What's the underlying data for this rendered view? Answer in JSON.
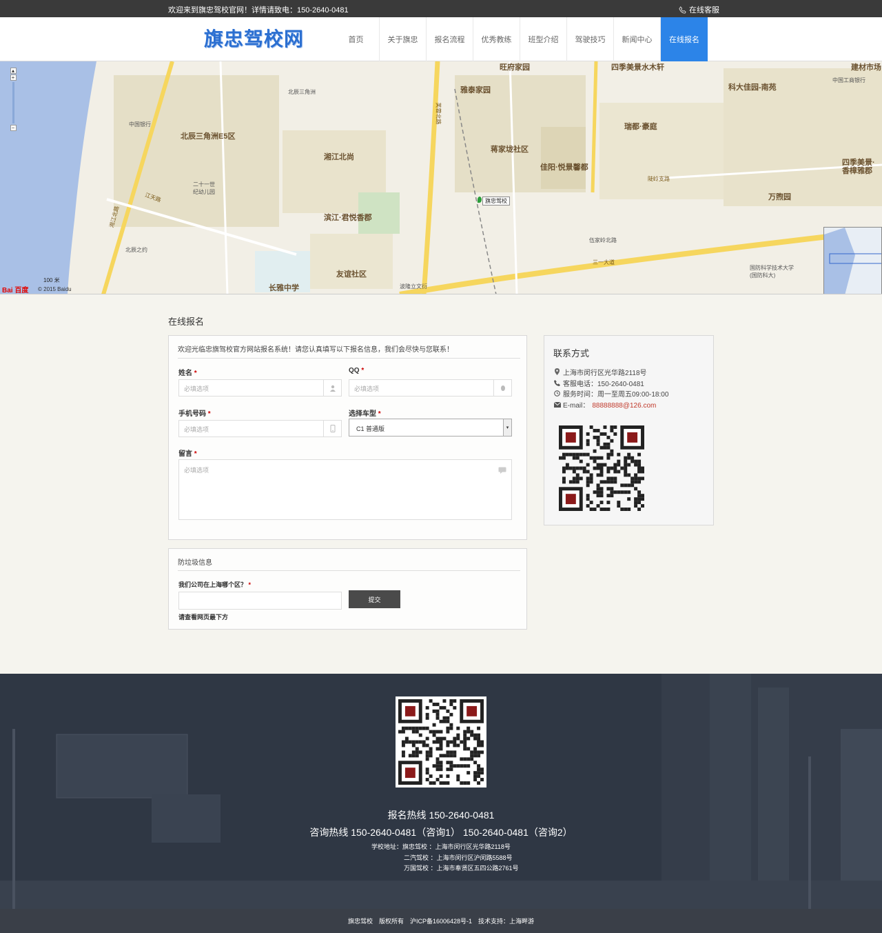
{
  "topbar": {
    "welcome": "欢迎来到旗忠驾校官网！详情请致电：150-2640-0481",
    "service": "在线客服"
  },
  "header": {
    "logo": "旗忠驾校网",
    "nav": [
      "首页",
      "关于旗忠",
      "报名流程",
      "优秀教练",
      "班型介绍",
      "驾驶技巧",
      "新闻中心",
      "在线报名"
    ],
    "active_nav": "在线报名"
  },
  "map": {
    "labels": {
      "l1": "北辰三角洲E5区",
      "l2": "湘江北尚",
      "l3": "滨江·君悦香郡",
      "l4": "雅泰家园",
      "l5": "蒋家垅社区",
      "l6": "佳阳·悦景馨都",
      "l7": "瑞都·豪庭",
      "l8": "科大佳园-南苑",
      "l9": "四季美景·香樟雅郡",
      "l10": "万煦园",
      "l11": "友谊社区",
      "l12": "长雅中学",
      "l13": "旺府家园",
      "l14": "四季美景水木轩",
      "l15": "建材市场",
      "l16": "北辰三角洲",
      "l17": "中国银行",
      "l18": "二十一世纪幼儿园",
      "l19": "江天路",
      "l20": "湘江北路",
      "l21": "芙蓉北路",
      "l22": "三一大道",
      "l23": "波隆立文衍",
      "l24": "中国工商银行",
      "l25": "国防科学技术大学(国防科大)",
      "l26": "陡岭支路",
      "l27": "伍家岭北路",
      "l28": "北辰之约"
    },
    "marker": "旗忠驾校",
    "scale": "100 米",
    "copyright": "© 2015 Baidu",
    "baidu": "Bai 百度"
  },
  "form": {
    "section_title": "在线报名",
    "intro": "欢迎光临忠旗驾校官方网站报名系统！请您认真填写以下报名信息，我们会尽快与您联系！",
    "name_label": "姓名",
    "qq_label": "QQ",
    "phone_label": "手机号码",
    "car_label": "选择车型",
    "message_label": "留言",
    "required_mark": "*",
    "placeholder": "必填选项",
    "car_selected": "C1 普通版"
  },
  "spam": {
    "title": "防垃圾信息",
    "question": "我们公司在上海哪个区？",
    "submit": "提交",
    "hint": "请查看网页最下方"
  },
  "contact": {
    "title": "联系方式",
    "address": "上海市闵行区光华路2118号",
    "phone": "客服电话：150-2640-0481",
    "hours": "服务时间：周一至周五09:00-18:00",
    "email_label": "E-mail：",
    "email": "88888888@126.com"
  },
  "footer": {
    "hotline1": "报名热线 150-2640-0481",
    "hotline2": "咨询热线 150-2640-0481（咨询1） 150-2640-0481（咨询2）",
    "addr1": "学校地址：旗忠驾校 ：上海市闵行区光华路2118号",
    "addr2": "二汽驾校 ：上海市闵行区沪闵路5588号",
    "addr3": "万国驾校 ：上海市奉贤区五四公路2761号",
    "copyright": [
      "旗忠驾校",
      "版权所有",
      "沪ICP备16006428号-1",
      "技术支持：上海畔游"
    ]
  }
}
